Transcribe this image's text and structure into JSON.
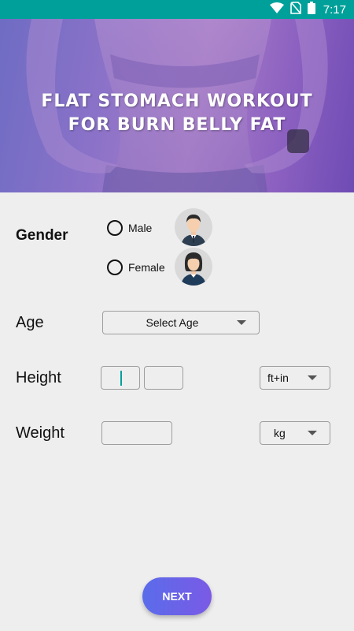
{
  "status_bar": {
    "time": "7:17",
    "icons": [
      "wifi-icon",
      "no-sim-icon",
      "battery-icon"
    ],
    "color": "#00a09a"
  },
  "hero": {
    "title_line1": "FLAT STOMACH WORKOUT",
    "title_line2": "FOR BURN BELLY FAT"
  },
  "form": {
    "gender": {
      "label": "Gender",
      "options": [
        {
          "label": "Male",
          "selected": false,
          "avatar": "male-avatar-icon"
        },
        {
          "label": "Female",
          "selected": false,
          "avatar": "female-avatar-icon"
        }
      ]
    },
    "age": {
      "label": "Age",
      "selected": "Select Age"
    },
    "height": {
      "label": "Height",
      "feet_value": "",
      "inches_value": "",
      "unit": "ft+in"
    },
    "weight": {
      "label": "Weight",
      "value": "",
      "unit": "kg"
    }
  },
  "next_button": {
    "label": "NEXT",
    "colors": [
      "#5a6cea",
      "#7a5ae6"
    ]
  }
}
